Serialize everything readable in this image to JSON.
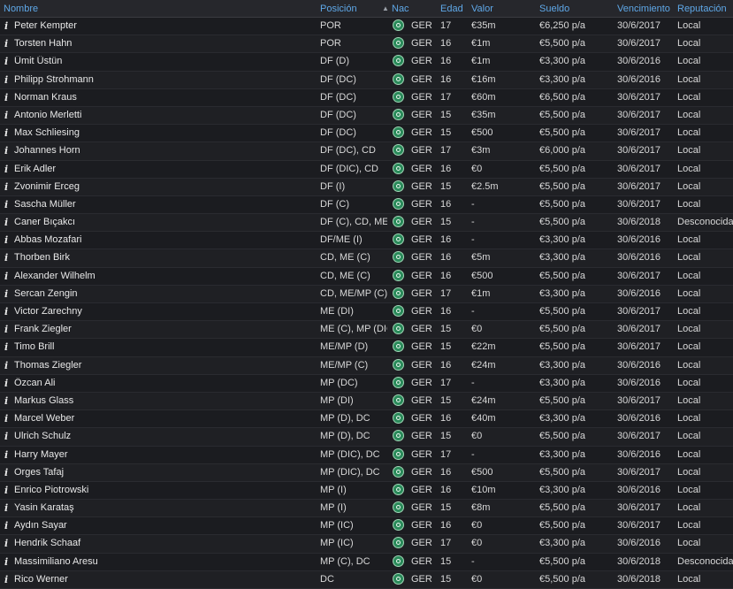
{
  "headers": {
    "name": "Nombre",
    "position": "Posición",
    "nat": "Nac",
    "age": "Edad",
    "value": "Valor",
    "wage": "Sueldo",
    "expires": "Vencimiento",
    "reputation": "Reputación"
  },
  "info_glyph": "i",
  "rows": [
    {
      "name": "Peter Kempter",
      "position": "POR",
      "nat": "GER",
      "age": "17",
      "value": "€35m",
      "wage": "€6,250 p/a",
      "expires": "30/6/2017",
      "reputation": "Local"
    },
    {
      "name": "Torsten Hahn",
      "position": "POR",
      "nat": "GER",
      "age": "16",
      "value": "€1m",
      "wage": "€5,500 p/a",
      "expires": "30/6/2017",
      "reputation": "Local"
    },
    {
      "name": "Ümit Üstün",
      "position": "DF (D)",
      "nat": "GER",
      "age": "16",
      "value": "€1m",
      "wage": "€3,300 p/a",
      "expires": "30/6/2016",
      "reputation": "Local"
    },
    {
      "name": "Philipp Strohmann",
      "position": "DF (DC)",
      "nat": "GER",
      "age": "16",
      "value": "€16m",
      "wage": "€3,300 p/a",
      "expires": "30/6/2016",
      "reputation": "Local"
    },
    {
      "name": "Norman Kraus",
      "position": "DF (DC)",
      "nat": "GER",
      "age": "17",
      "value": "€60m",
      "wage": "€6,500 p/a",
      "expires": "30/6/2017",
      "reputation": "Local"
    },
    {
      "name": "Antonio Merletti",
      "position": "DF (DC)",
      "nat": "GER",
      "age": "15",
      "value": "€35m",
      "wage": "€5,500 p/a",
      "expires": "30/6/2017",
      "reputation": "Local"
    },
    {
      "name": "Max Schliesing",
      "position": "DF (DC)",
      "nat": "GER",
      "age": "15",
      "value": "€500",
      "wage": "€5,500 p/a",
      "expires": "30/6/2017",
      "reputation": "Local"
    },
    {
      "name": "Johannes Horn",
      "position": "DF (DC), CD",
      "nat": "GER",
      "age": "17",
      "value": "€3m",
      "wage": "€6,000 p/a",
      "expires": "30/6/2017",
      "reputation": "Local"
    },
    {
      "name": "Erik Adler",
      "position": "DF (DIC), CD",
      "nat": "GER",
      "age": "16",
      "value": "€0",
      "wage": "€5,500 p/a",
      "expires": "30/6/2017",
      "reputation": "Local"
    },
    {
      "name": "Zvonimir Erceg",
      "position": "DF (I)",
      "nat": "GER",
      "age": "15",
      "value": "€2.5m",
      "wage": "€5,500 p/a",
      "expires": "30/6/2017",
      "reputation": "Local"
    },
    {
      "name": "Sascha Müller",
      "position": "DF (C)",
      "nat": "GER",
      "age": "16",
      "value": "-",
      "wage": "€5,500 p/a",
      "expires": "30/6/2017",
      "reputation": "Local"
    },
    {
      "name": "Caner Bıçakcı",
      "position": "DF (C), CD, ME ...",
      "nat": "GER",
      "age": "15",
      "value": "-",
      "wage": "€5,500 p/a",
      "expires": "30/6/2018",
      "reputation": "Desconocida"
    },
    {
      "name": "Abbas Mozafari",
      "position": "DF/ME (I)",
      "nat": "GER",
      "age": "16",
      "value": "-",
      "wage": "€3,300 p/a",
      "expires": "30/6/2016",
      "reputation": "Local"
    },
    {
      "name": "Thorben Birk",
      "position": "CD, ME (C)",
      "nat": "GER",
      "age": "16",
      "value": "€5m",
      "wage": "€3,300 p/a",
      "expires": "30/6/2016",
      "reputation": "Local"
    },
    {
      "name": "Alexander Wilhelm",
      "position": "CD, ME (C)",
      "nat": "GER",
      "age": "16",
      "value": "€500",
      "wage": "€5,500 p/a",
      "expires": "30/6/2017",
      "reputation": "Local"
    },
    {
      "name": "Sercan Zengin",
      "position": "CD, ME/MP (C)",
      "nat": "GER",
      "age": "17",
      "value": "€1m",
      "wage": "€3,300 p/a",
      "expires": "30/6/2016",
      "reputation": "Local"
    },
    {
      "name": "Victor Zarechny",
      "position": "ME (DI)",
      "nat": "GER",
      "age": "16",
      "value": "-",
      "wage": "€5,500 p/a",
      "expires": "30/6/2017",
      "reputation": "Local"
    },
    {
      "name": "Frank Ziegler",
      "position": "ME (C), MP (DIC)",
      "nat": "GER",
      "age": "15",
      "value": "€0",
      "wage": "€5,500 p/a",
      "expires": "30/6/2017",
      "reputation": "Local"
    },
    {
      "name": "Timo Brill",
      "position": "ME/MP (D)",
      "nat": "GER",
      "age": "15",
      "value": "€22m",
      "wage": "€5,500 p/a",
      "expires": "30/6/2017",
      "reputation": "Local"
    },
    {
      "name": "Thomas Ziegler",
      "position": "ME/MP (C)",
      "nat": "GER",
      "age": "16",
      "value": "€24m",
      "wage": "€3,300 p/a",
      "expires": "30/6/2016",
      "reputation": "Local"
    },
    {
      "name": "Özcan Ali",
      "position": "MP (DC)",
      "nat": "GER",
      "age": "17",
      "value": "-",
      "wage": "€3,300 p/a",
      "expires": "30/6/2016",
      "reputation": "Local"
    },
    {
      "name": "Markus Glass",
      "position": "MP (DI)",
      "nat": "GER",
      "age": "15",
      "value": "€24m",
      "wage": "€5,500 p/a",
      "expires": "30/6/2017",
      "reputation": "Local"
    },
    {
      "name": "Marcel Weber",
      "position": "MP (D), DC",
      "nat": "GER",
      "age": "16",
      "value": "€40m",
      "wage": "€3,300 p/a",
      "expires": "30/6/2016",
      "reputation": "Local"
    },
    {
      "name": "Ulrich Schulz",
      "position": "MP (D), DC",
      "nat": "GER",
      "age": "15",
      "value": "€0",
      "wage": "€5,500 p/a",
      "expires": "30/6/2017",
      "reputation": "Local"
    },
    {
      "name": "Harry Mayer",
      "position": "MP (DIC), DC",
      "nat": "GER",
      "age": "17",
      "value": "-",
      "wage": "€3,300 p/a",
      "expires": "30/6/2016",
      "reputation": "Local"
    },
    {
      "name": "Orges Tafaj",
      "position": "MP (DIC), DC",
      "nat": "GER",
      "age": "16",
      "value": "€500",
      "wage": "€5,500 p/a",
      "expires": "30/6/2017",
      "reputation": "Local"
    },
    {
      "name": "Enrico Piotrowski",
      "position": "MP (I)",
      "nat": "GER",
      "age": "16",
      "value": "€10m",
      "wage": "€3,300 p/a",
      "expires": "30/6/2016",
      "reputation": "Local"
    },
    {
      "name": "Yasin Karataş",
      "position": "MP (I)",
      "nat": "GER",
      "age": "15",
      "value": "€8m",
      "wage": "€5,500 p/a",
      "expires": "30/6/2017",
      "reputation": "Local"
    },
    {
      "name": "Aydın Sayar",
      "position": "MP (IC)",
      "nat": "GER",
      "age": "16",
      "value": "€0",
      "wage": "€5,500 p/a",
      "expires": "30/6/2017",
      "reputation": "Local"
    },
    {
      "name": "Hendrik Schaaf",
      "position": "MP (IC)",
      "nat": "GER",
      "age": "17",
      "value": "€0",
      "wage": "€3,300 p/a",
      "expires": "30/6/2016",
      "reputation": "Local"
    },
    {
      "name": "Massimiliano Aresu",
      "position": "MP (C), DC",
      "nat": "GER",
      "age": "15",
      "value": "-",
      "wage": "€5,500 p/a",
      "expires": "30/6/2018",
      "reputation": "Desconocida"
    },
    {
      "name": "Rico Werner",
      "position": "DC",
      "nat": "GER",
      "age": "15",
      "value": "€0",
      "wage": "€5,500 p/a",
      "expires": "30/6/2018",
      "reputation": "Local"
    }
  ]
}
